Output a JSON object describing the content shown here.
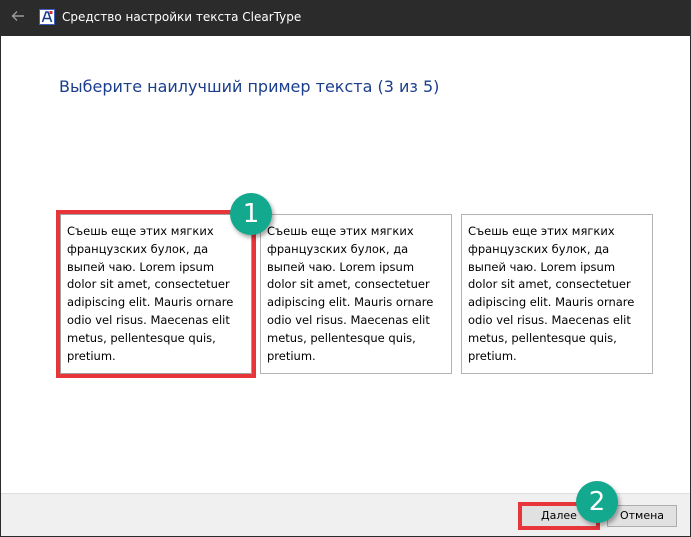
{
  "window": {
    "title": "Средство настройки текста ClearType",
    "icon": "cleartype-app-icon",
    "back_icon": "back-arrow-icon"
  },
  "main": {
    "heading": "Выберите наилучший пример текста (3 из 5)",
    "samples": [
      {
        "text": "Съешь еще этих мягких французских булок, да выпей чаю. Lorem ipsum dolor sit amet, consectetuer adipiscing elit. Mauris ornare odio vel risus. Maecenas elit metus, pellentesque quis, pretium.",
        "selected": true
      },
      {
        "text": "Съешь еще этих мягких французских булок, да выпей чаю. Lorem ipsum dolor sit amet, consectetuer adipiscing elit. Mauris ornare odio vel risus. Maecenas elit metus, pellentesque quis, pretium.",
        "selected": false
      },
      {
        "text": "Съешь еще этих мягких французских булок, да выпей чаю. Lorem ipsum dolor sit amet, consectetuer adipiscing elit. Mauris ornare odio vel risus. Maecenas elit metus, pellentesque quis, pretium.",
        "selected": false
      }
    ]
  },
  "annotations": {
    "badge_1": "1",
    "badge_2": "2",
    "color": "#12a98e",
    "highlight_color": "#e8353a"
  },
  "footer": {
    "next_label": "Далее",
    "cancel_label": "Отмена"
  }
}
